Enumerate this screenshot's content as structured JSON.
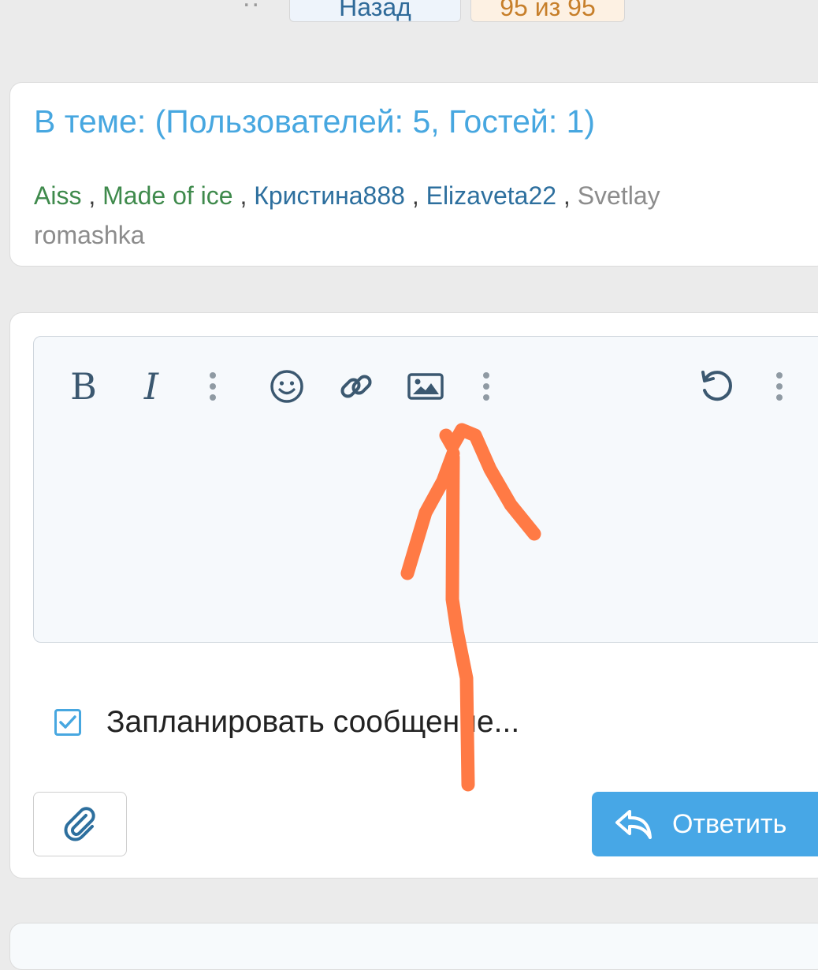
{
  "pager": {
    "dots": "..",
    "back_label": "Назад",
    "count_label": "95 из 95"
  },
  "online": {
    "title": "В теме: (Пользователей: 5, Гостей: 1)",
    "separator": ",",
    "users": [
      {
        "name": "Aiss",
        "color": "#3f8a4c"
      },
      {
        "name": "Made of ice",
        "color": "#3f8a4c"
      },
      {
        "name": "Кристина888",
        "color": "#2d6f9e"
      },
      {
        "name": "Elizaveta22",
        "color": "#2d6f9e"
      },
      {
        "name": "Svetlay romashka",
        "color": "#8c8c8c"
      }
    ]
  },
  "editor": {
    "toolbar": {
      "bold_label": "B",
      "italic_label": "I",
      "icons": [
        "bold-icon",
        "italic-icon",
        "more-options-icon",
        "emoji-icon",
        "link-icon",
        "image-icon",
        "more-options-icon",
        "undo-icon",
        "more-options-icon"
      ]
    },
    "content": ""
  },
  "schedule": {
    "checked": true,
    "label": "Запланировать сообщение..."
  },
  "actions": {
    "attach_icon": "paperclip-icon",
    "reply_label": "Ответить",
    "reply_icon": "reply-icon"
  },
  "colors": {
    "accent": "#47a7e0",
    "reply_button": "#47a7e6",
    "annotation": "#ff7a45",
    "background": "#ebebeb"
  }
}
